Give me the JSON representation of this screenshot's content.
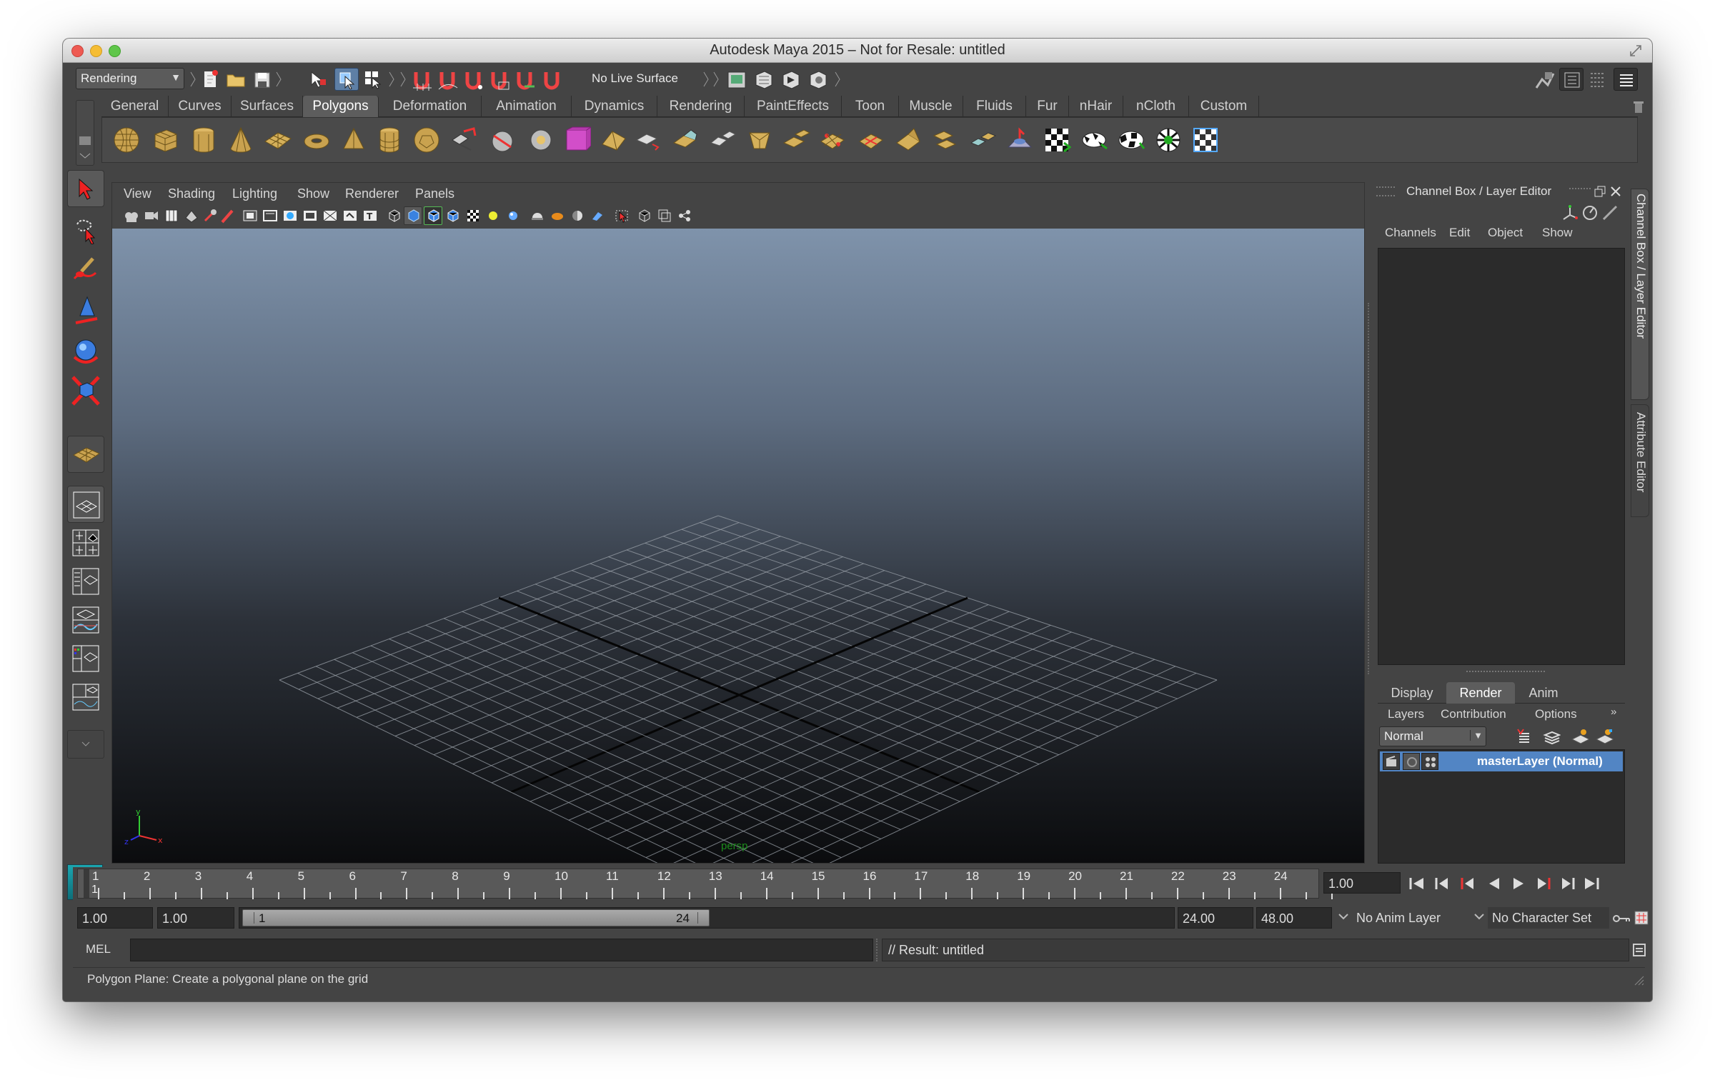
{
  "window": {
    "title": "Autodesk Maya 2015 – Not for Resale: untitled"
  },
  "status_line": {
    "menu_set": "Rendering",
    "live_surface": "No Live Surface"
  },
  "shelf": {
    "tabs": [
      "General",
      "Curves",
      "Surfaces",
      "Polygons",
      "Deformation",
      "Animation",
      "Dynamics",
      "Rendering",
      "PaintEffects",
      "Toon",
      "Muscle",
      "Fluids",
      "Fur",
      "nHair",
      "nCloth",
      "Custom"
    ],
    "active_tab": "Polygons"
  },
  "viewport": {
    "menus": [
      "View",
      "Shading",
      "Lighting",
      "Show",
      "Renderer",
      "Panels"
    ],
    "camera_label": "persp",
    "axis": {
      "y": "y",
      "x": "x",
      "z": "z"
    }
  },
  "channel_box": {
    "title": "Channel Box / Layer Editor",
    "menus": [
      "Channels",
      "Edit",
      "Object",
      "Show"
    ],
    "side_tabs": [
      "Channel Box / Layer Editor",
      "Attribute Editor"
    ]
  },
  "layer_editor": {
    "tabs": [
      "Display",
      "Render",
      "Anim"
    ],
    "active_tab": "Render",
    "menus": [
      "Layers",
      "Contribution",
      "Options"
    ],
    "blend_mode": "Normal",
    "layer_name": "masterLayer (Normal)"
  },
  "time_slider": {
    "ticks": [
      "1",
      "2",
      "3",
      "4",
      "5",
      "6",
      "7",
      "8",
      "9",
      "10",
      "11",
      "12",
      "13",
      "14",
      "15",
      "16",
      "17",
      "18",
      "19",
      "20",
      "21",
      "22",
      "23",
      "24"
    ],
    "current_frame_marker": "1",
    "current_time": "1.00"
  },
  "range_slider": {
    "start_time": "1.00",
    "playback_start": "1.00",
    "range_start_label": "1",
    "range_end_label": "24",
    "playback_end": "24.00",
    "end_time": "48.00",
    "anim_layer": "No Anim Layer",
    "character_set": "No Character Set"
  },
  "command_line": {
    "label": "MEL",
    "result": "// Result: untitled"
  },
  "help_line": {
    "text": "Polygon Plane: Create a polygonal plane on the grid"
  },
  "colors": {
    "panel": "#444444",
    "selection": "#5285c4",
    "viewport_top": "#7f93ab",
    "viewport_bottom": "#0b0c0e"
  }
}
